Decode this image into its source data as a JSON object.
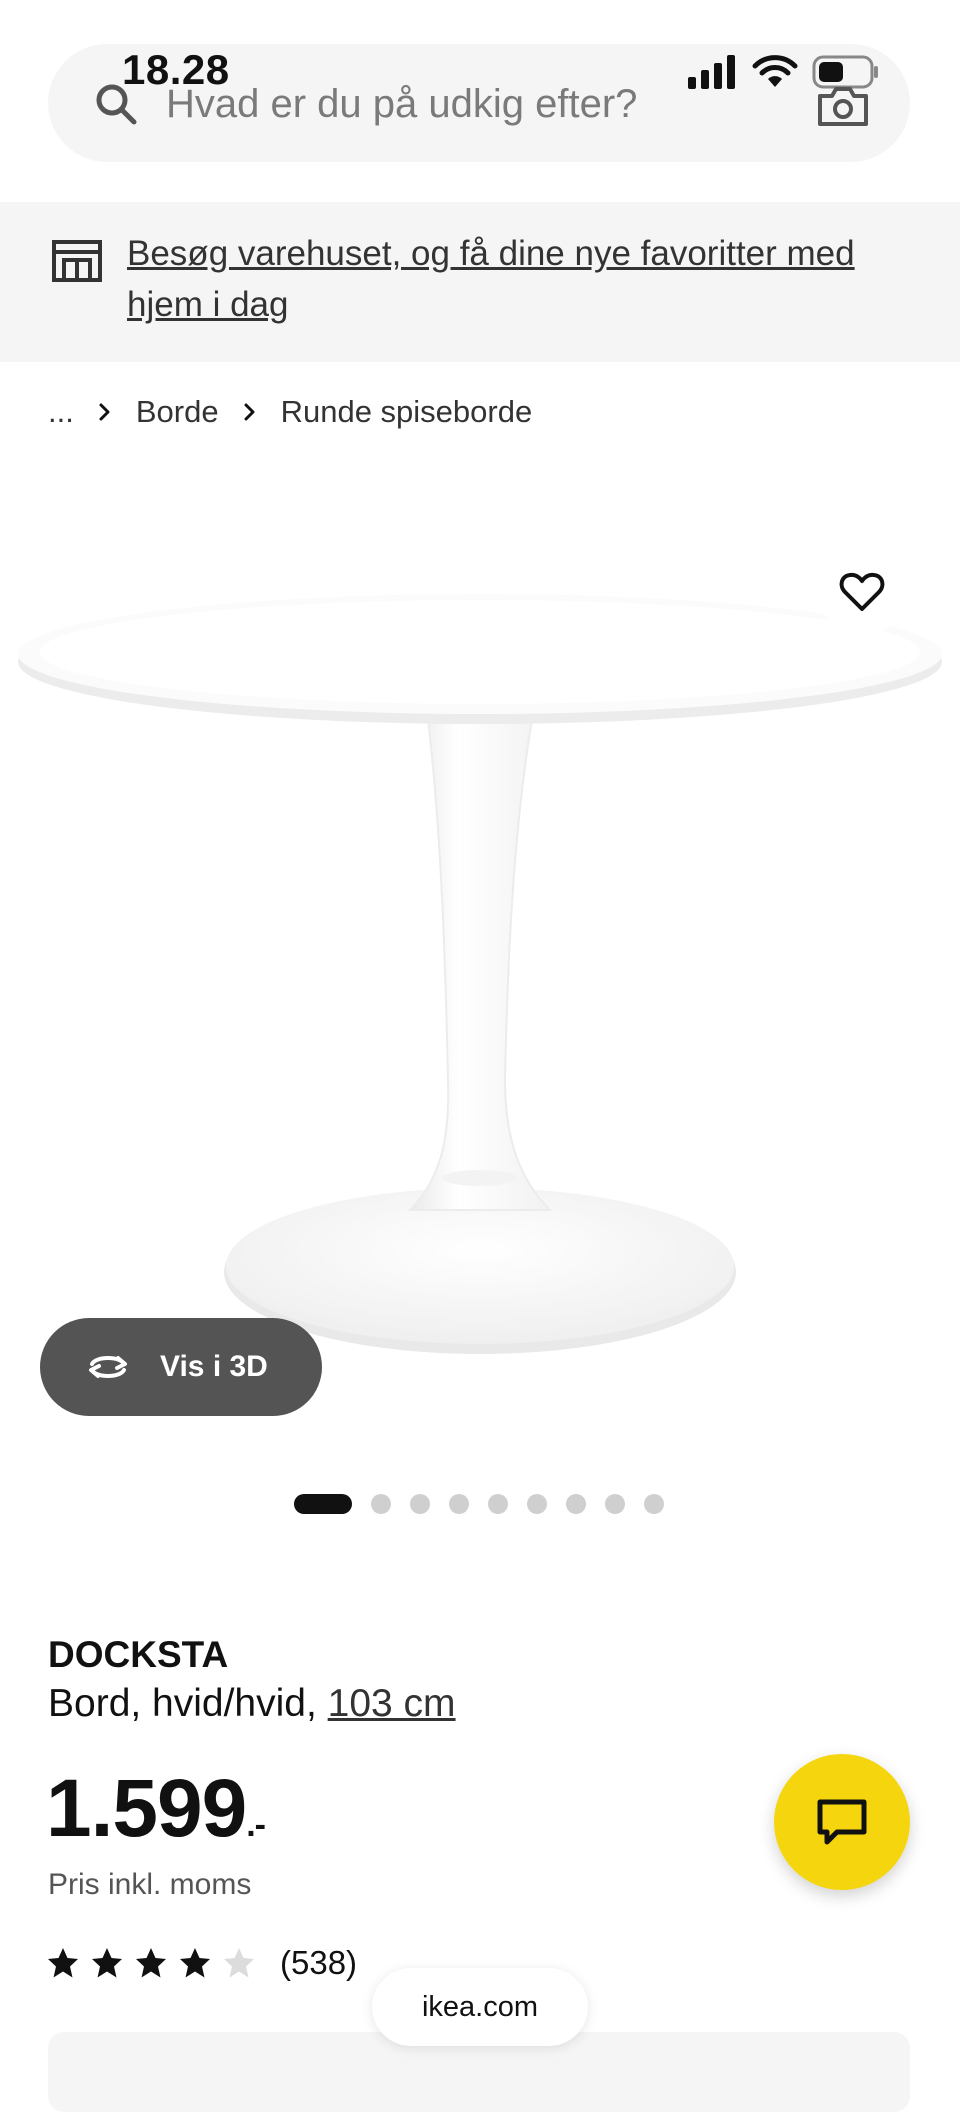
{
  "status_bar": {
    "time": "18.28",
    "icons": [
      "signal-icon",
      "wifi-icon",
      "battery-icon"
    ]
  },
  "search": {
    "placeholder": "Hvad er du på udkig efter?",
    "icons": [
      "search-icon",
      "camera-icon"
    ]
  },
  "banner": {
    "icon": "store-icon",
    "text": "Besøg varehuset, og få dine nye favoritter med hjem i dag"
  },
  "breadcrumb": {
    "items": [
      "...",
      "Borde",
      "Runde spiseborde"
    ]
  },
  "gallery": {
    "view3d_label": "Vis i 3D",
    "image_count": 9,
    "active_index": 0
  },
  "product": {
    "name": "DOCKSTA",
    "description": "Bord, hvid/hvid, ",
    "size": "103 cm",
    "price": "1.599",
    "price_suffix": ".-",
    "price_note": "Pris inkl. moms",
    "rating": 4,
    "rating_max": 5,
    "rating_count": "(538)"
  },
  "browser": {
    "domain": "ikea.com"
  },
  "colors": {
    "accent_yellow": "#f5d60e",
    "pill_bg": "#f5f5f5",
    "button_dark": "#545454"
  }
}
